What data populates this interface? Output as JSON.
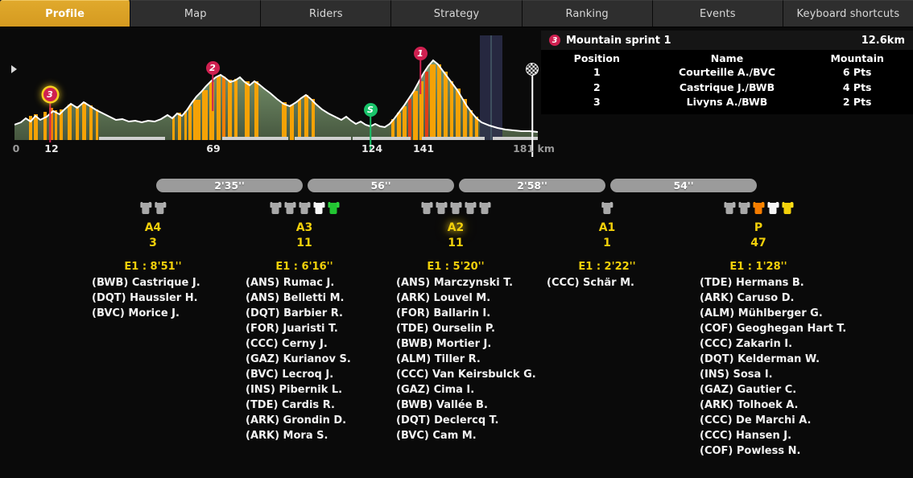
{
  "tabs": [
    {
      "label": "Profile",
      "active": true
    },
    {
      "label": "Map",
      "active": false
    },
    {
      "label": "Riders",
      "active": false
    },
    {
      "label": "Strategy",
      "active": false
    },
    {
      "label": "Ranking",
      "active": false
    },
    {
      "label": "Events",
      "active": false
    },
    {
      "label": "Keyboard shortcuts",
      "active": false
    }
  ],
  "profile": {
    "axis_ticks": [
      "0",
      "12",
      "69",
      "124",
      "141",
      "181 km"
    ],
    "markers": [
      {
        "id": "3",
        "type": "mountain",
        "selected": true
      },
      {
        "id": "2",
        "type": "mountain",
        "selected": false
      },
      {
        "id": "S",
        "type": "sprint",
        "selected": false
      },
      {
        "id": "1",
        "type": "mountain",
        "selected": false
      }
    ],
    "finish_icon": "checkered-flag-icon",
    "expand_icon": "play-triangle-icon"
  },
  "sprint_panel": {
    "badge": "3",
    "title": "Mountain sprint 1",
    "distance": "12.6km",
    "columns": [
      "Position",
      "Name",
      "Mountain"
    ],
    "rows": [
      {
        "position": "1",
        "name": "Courteille A./BVC",
        "mountain": "6 Pts"
      },
      {
        "position": "2",
        "name": "Castrique J./BWB",
        "mountain": "4 Pts"
      },
      {
        "position": "3",
        "name": "Livyns A./BWB",
        "mountain": "2 Pts"
      }
    ]
  },
  "gaps": [
    {
      "label": "2'35''"
    },
    {
      "label": "56''"
    },
    {
      "label": "2'58''"
    },
    {
      "label": "54''"
    }
  ],
  "groups": [
    {
      "name": "A4",
      "count": "3",
      "eta": "E1 : 8'51''",
      "highlight": false,
      "jerseys": [
        "grey",
        "grey"
      ],
      "riders": [
        "(BWB) Castrique J.",
        "(DQT) Haussler H.",
        "(BVC) Morice J."
      ]
    },
    {
      "name": "A3",
      "count": "11",
      "eta": "E1 : 6'16''",
      "highlight": false,
      "jerseys": [
        "grey",
        "grey",
        "grey",
        "polkadot",
        "green"
      ],
      "riders": [
        "(ANS) Rumac J.",
        "(ANS) Belletti M.",
        "(DQT) Barbier R.",
        "(FOR) Juaristi T.",
        "(CCC) Cerny J.",
        "(GAZ) Kurianov S.",
        "(BVC) Lecroq J.",
        "(INS) Pibernik L.",
        "(TDE) Cardis R.",
        "(ARK) Grondin D.",
        "(ARK) Mora S."
      ]
    },
    {
      "name": "A2",
      "count": "11",
      "eta": "E1 : 5'20''",
      "highlight": true,
      "jerseys": [
        "grey",
        "grey",
        "grey",
        "grey",
        "grey"
      ],
      "riders": [
        "(ANS) Marczynski T.",
        "(ARK) Louvel M.",
        "(FOR) Ballarin I.",
        "(TDE) Ourselin P.",
        "(BWB) Mortier J.",
        "(ALM) Tiller R.",
        "(CCC) Van Keirsbulck G.",
        "(GAZ) Cima I.",
        "(BWB) Vallée B.",
        "(DQT) Declercq T.",
        "(BVC) Cam M."
      ]
    },
    {
      "name": "A1",
      "count": "1",
      "eta": "E1 : 2'22''",
      "highlight": false,
      "jerseys": [
        "grey"
      ],
      "riders": [
        "(CCC) Schär M."
      ]
    },
    {
      "name": "P",
      "count": "47",
      "eta": "E1 : 1'28''",
      "highlight": false,
      "jerseys": [
        "grey",
        "grey",
        "orange",
        "white",
        "yellow"
      ],
      "riders": [
        "(TDE) Hermans B.",
        "(ARK) Caruso D.",
        "(ALM) Mühlberger G.",
        "(COF) Geoghegan Hart T.",
        "(CCC) Zakarin I.",
        "(DQT) Kelderman W.",
        "(INS) Sosa I.",
        "(GAZ) Gautier C.",
        "(ARK) Tolhoek A.",
        "(CCC) De Marchi A.",
        "(CCC) Hansen J.",
        "(COF) Powless N."
      ]
    }
  ],
  "colors": {
    "accent": "#e0a92c",
    "yellow_text": "#f2d00a",
    "marker_red": "#cf2050",
    "sprint_green": "#19c46a",
    "gap_bar": "#9b9b9b"
  }
}
